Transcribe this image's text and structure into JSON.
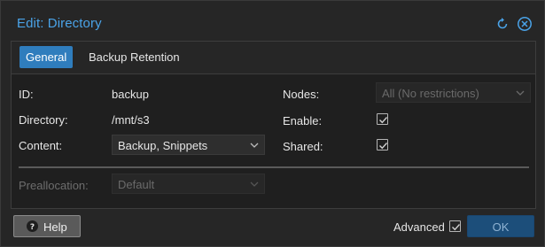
{
  "window": {
    "title": "Edit: Directory",
    "reset_icon": "reset-icon",
    "close_icon": "close-icon"
  },
  "tabs": [
    {
      "label": "General",
      "active": true
    },
    {
      "label": "Backup Retention",
      "active": false
    }
  ],
  "form": {
    "id_label": "ID:",
    "id_value": "backup",
    "directory_label": "Directory:",
    "directory_value": "/mnt/s3",
    "content_label": "Content:",
    "content_value": "Backup, Snippets",
    "nodes_label": "Nodes:",
    "nodes_value": "All (No restrictions)",
    "enable_label": "Enable:",
    "enable_checked": true,
    "shared_label": "Shared:",
    "shared_checked": true,
    "preallocation_label": "Preallocation:",
    "preallocation_value": "Default"
  },
  "footer": {
    "help_label": "Help",
    "advanced_label": "Advanced",
    "advanced_checked": true,
    "ok_label": "OK"
  },
  "colors": {
    "accent": "#2f7dbd",
    "title_text": "#4aa3e8",
    "ok_button": "#1c4e7a"
  }
}
